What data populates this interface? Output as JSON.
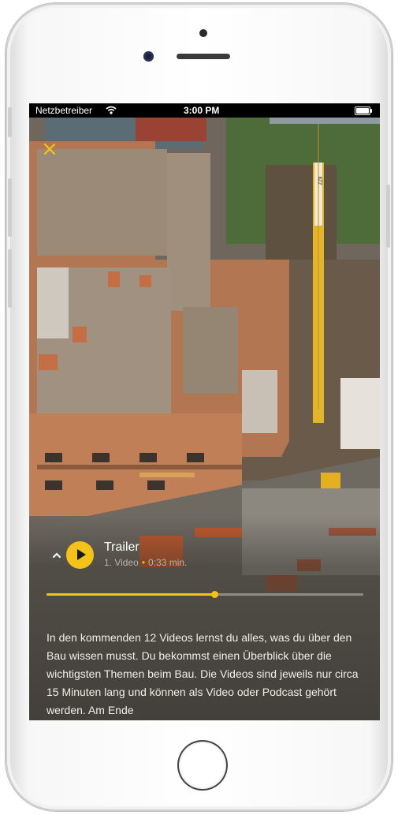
{
  "status_bar": {
    "carrier": "Netzbetreiber",
    "time": "3:00 PM"
  },
  "player": {
    "title": "Trailer",
    "episode": "1. Video",
    "duration": "0:33 min.",
    "progress": 0.53
  },
  "description": "In den kommenden 12 Videos lernst du alles, was du über den Bau wissen musst. Du bekommst einen Überblick über die wichtigsten Themen beim Bau. Die Videos sind jeweils nur circa 15 Minuten lang und können als Video oder Podcast gehört werden. Am Ende",
  "crane_sign": "ZZ8",
  "colors": {
    "accent": "#f4c219",
    "text": "#ffffff"
  },
  "icons": [
    "close-icon",
    "wifi-icon",
    "battery-icon",
    "chevron-up-icon",
    "play-icon"
  ]
}
